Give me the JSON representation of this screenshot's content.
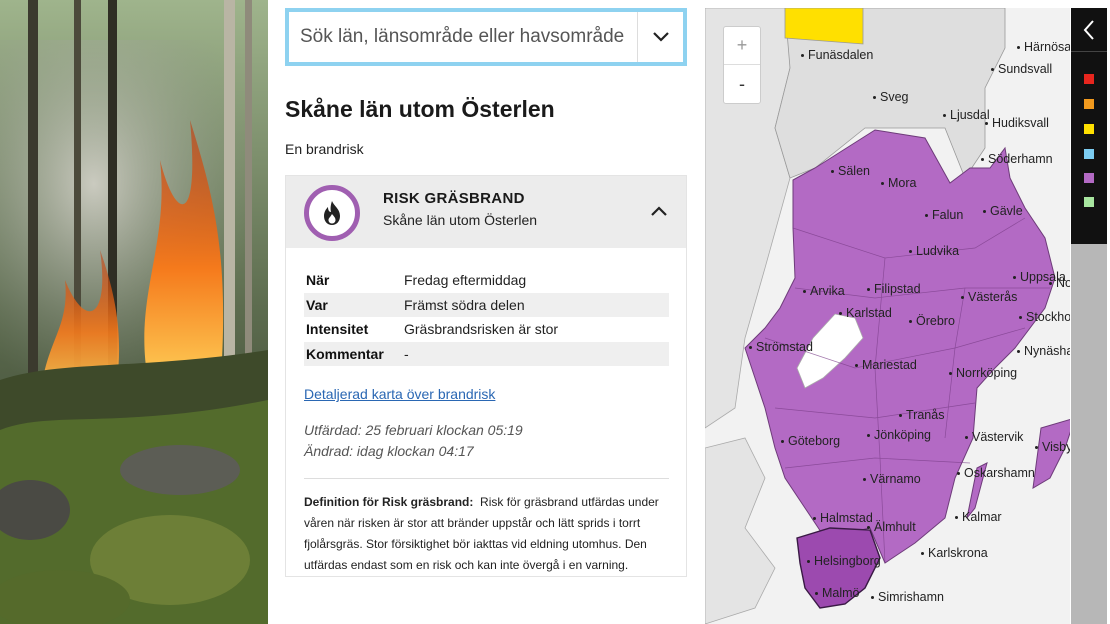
{
  "search": {
    "placeholder": "Sök län, länsområde eller havsområde"
  },
  "area": {
    "title": "Skåne län utom Österlen",
    "subtitle": "En brandrisk"
  },
  "risk_card": {
    "title": "RISK GRÄSBRAND",
    "subtitle": "Skåne län utom Österlen",
    "badge_color": "#a05fb1",
    "icon": "flame-icon",
    "rows": [
      {
        "label": "När",
        "value": "Fredag eftermiddag"
      },
      {
        "label": "Var",
        "value": "Främst södra delen"
      },
      {
        "label": "Intensitet",
        "value": "Gräsbrandsrisken är stor"
      },
      {
        "label": "Kommentar",
        "value": "-"
      }
    ],
    "map_link": "Detaljerad karta över brandrisk",
    "issued": "Utfärdad: 25 februari klockan 05:19",
    "changed": "Ändrad: idag klockan 04:17",
    "definition_label": "Definition för Risk gräsbrand:",
    "definition_text": "Risk för gräsbrand utfärdas under våren när risken är stor att bränder uppstår och lätt sprids i torrt fjolårsgräs. Stor försiktighet bör iakttas vid eldning utomhus. Den utfärdas endast som en risk och kan inte övergå i en varning."
  },
  "map": {
    "zoom_in": "+",
    "zoom_out": "-",
    "region_color": "#b36ac4",
    "highlight_color": "#9c4aaf",
    "cities": [
      "Funäsdalen",
      "Härnösand",
      "Sundsvall",
      "Sveg",
      "Ljusdal",
      "Hudiksvall",
      "Söderhamn",
      "Sälen",
      "Mora",
      "Falun",
      "Gävle",
      "Ludvika",
      "Uppsala",
      "Norrtälje",
      "Arvika",
      "Filipstad",
      "Västerås",
      "Karlstad",
      "Örebro",
      "Stockholm",
      "Strömstad",
      "Nynäshamn",
      "Mariestad",
      "Norrköping",
      "Tranås",
      "Göteborg",
      "Jönköping",
      "Västervik",
      "Visby",
      "Värnamo",
      "Oskarshamn",
      "Halmstad",
      "Älmhult",
      "Kalmar",
      "Karlskrona",
      "Helsingborg",
      "Malmö",
      "Simrishamn"
    ]
  },
  "legend": {
    "back_icon": "chevron-left-icon",
    "colors": [
      "#e8261e",
      "#f29a1e",
      "#ffe000",
      "#7ccdf2",
      "#b36ac4",
      "#a8e6a0"
    ]
  }
}
